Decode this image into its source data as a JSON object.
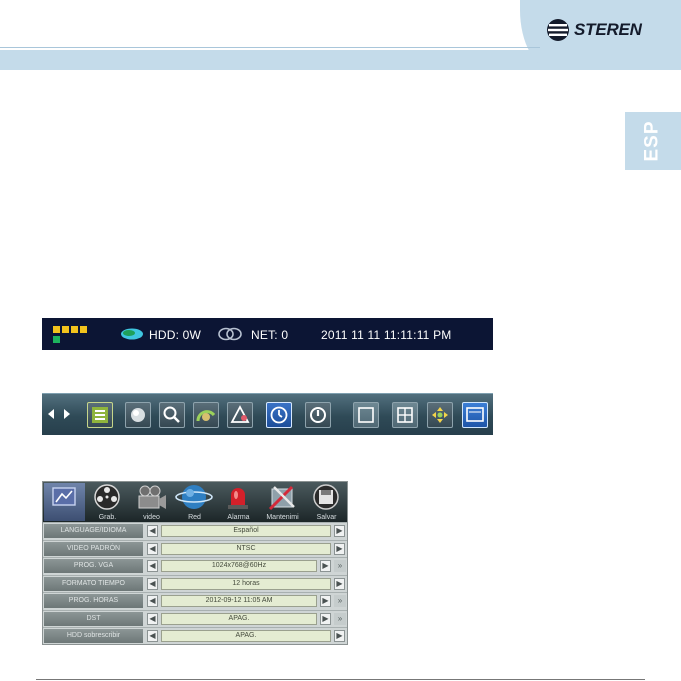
{
  "brand": {
    "name": "STEREN"
  },
  "language_tab": "ESP",
  "status_bar": {
    "hdd": "HDD: 0W",
    "net": "NET: 0",
    "datetime": "2011  11  11  11:11:11 PM",
    "colors": {
      "background": "#0c1534",
      "squares": "#f2c31c",
      "green_square": "#1db35d"
    }
  },
  "toolbar": {
    "buttons": [
      "channel-list-icon",
      "record-icon",
      "search-icon",
      "ptz-icon",
      "alarm-icon",
      "schedule-icon",
      "power-icon",
      "single-view-icon",
      "quad-view-icon",
      "move-icon",
      "monitor-icon"
    ]
  },
  "menu": {
    "tabs": [
      {
        "label": "",
        "icon": "system-icon",
        "selected": true
      },
      {
        "label": "Grab.",
        "icon": "film-reel-icon"
      },
      {
        "label": "video",
        "icon": "camera-icon"
      },
      {
        "label": "Red",
        "icon": "globe-icon"
      },
      {
        "label": "Alarma",
        "icon": "siren-icon"
      },
      {
        "label": "Mantenimi",
        "icon": "tools-icon"
      },
      {
        "label": "Salvar",
        "icon": "save-icon"
      }
    ],
    "rows": [
      {
        "label": "LANGUAGE/IDIOMA",
        "value": "Español",
        "more": false
      },
      {
        "label": "VIDEO PADRÓN",
        "value": "NTSC",
        "more": false
      },
      {
        "label": "PROG. VGA",
        "value": "1024x768@60Hz",
        "more": true
      },
      {
        "label": "FORMATO TIEMPO",
        "value": "12 horas",
        "more": false
      },
      {
        "label": "PROG. HORAS",
        "value": "2012-09-12 11:05  AM",
        "more": true
      },
      {
        "label": "DST",
        "value": "APAG.",
        "more": true
      },
      {
        "label": "HDD sobrescribir",
        "value": "APAG.",
        "more": false
      }
    ]
  }
}
